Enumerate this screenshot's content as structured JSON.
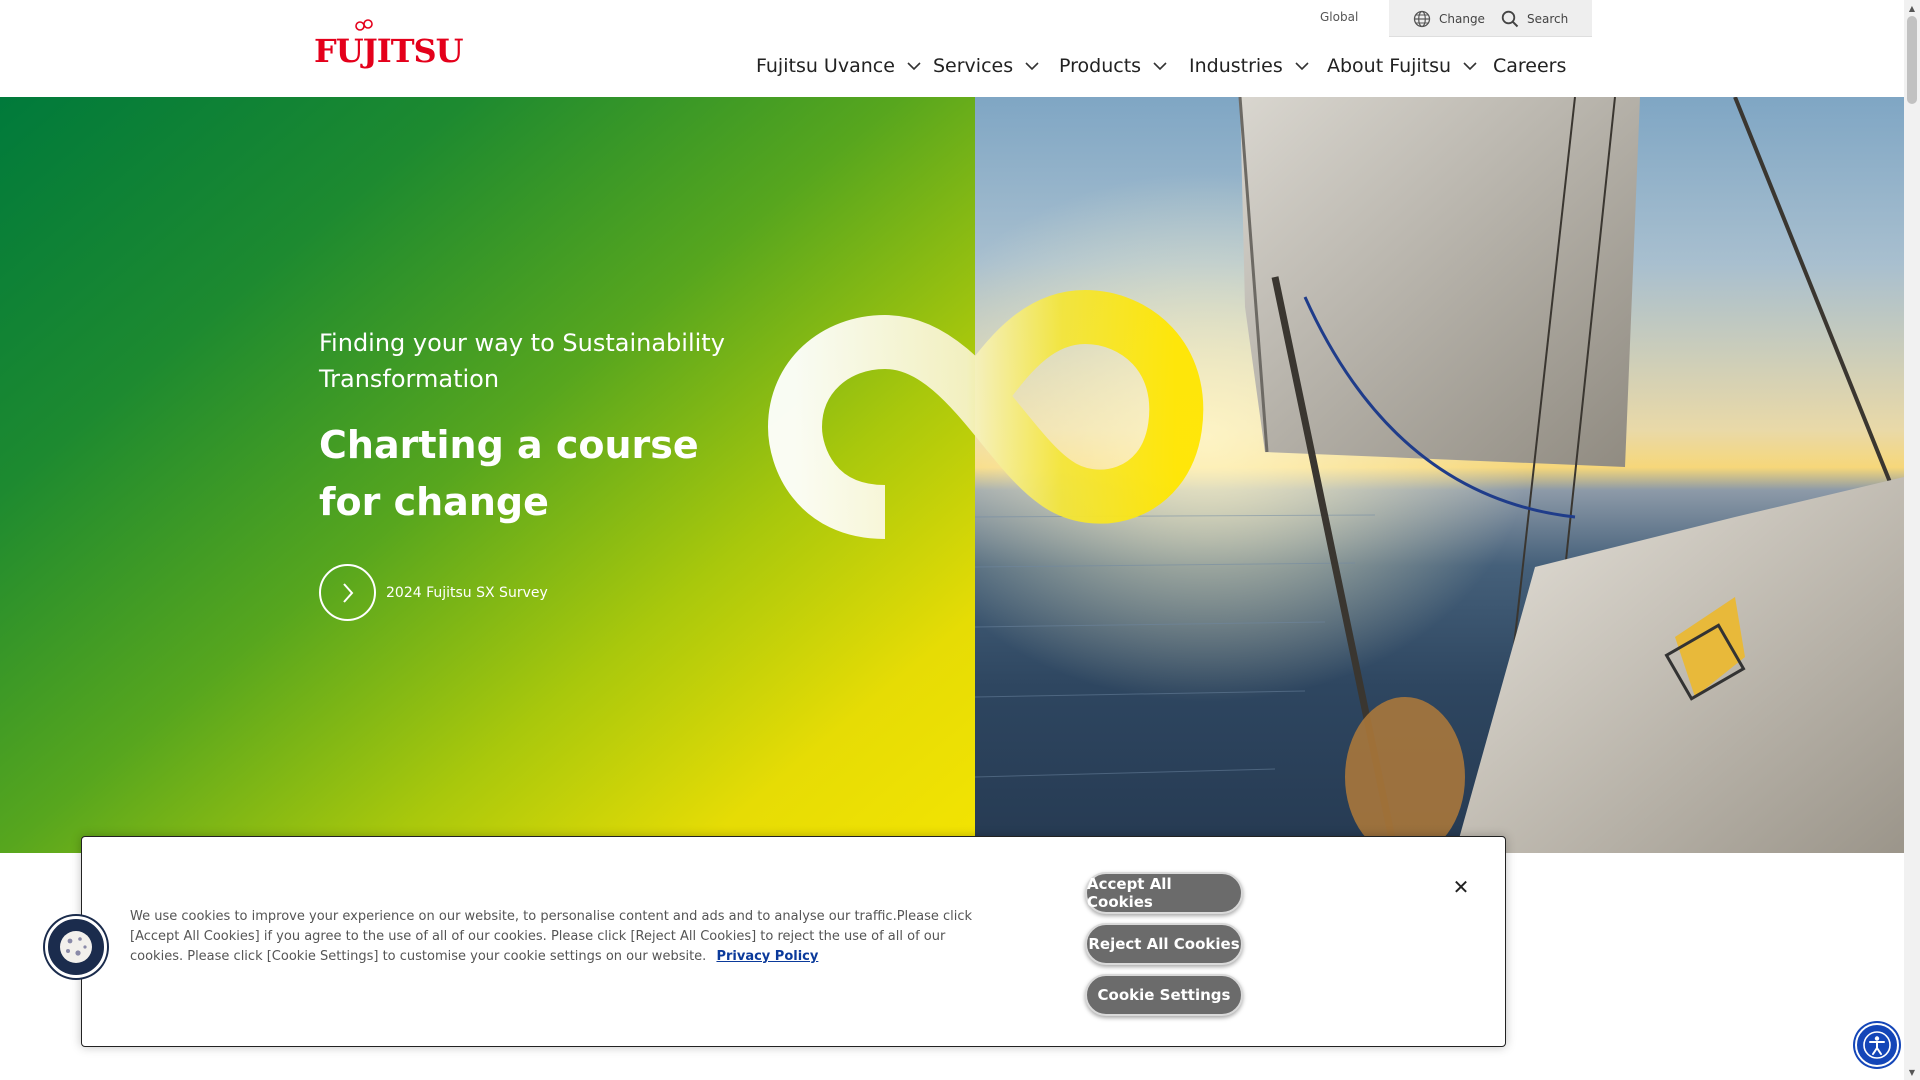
{
  "logo": {
    "text": "FUJITSU"
  },
  "utility": {
    "global_label": "Global",
    "change_label": "Change",
    "search_label": "Search"
  },
  "nav": {
    "items": [
      {
        "label": "Fujitsu Uvance",
        "has_dropdown": true
      },
      {
        "label": "Services",
        "has_dropdown": true
      },
      {
        "label": "Products",
        "has_dropdown": true
      },
      {
        "label": "Industries",
        "has_dropdown": true
      },
      {
        "label": "About Fujitsu",
        "has_dropdown": true
      },
      {
        "label": "Careers",
        "has_dropdown": false
      }
    ]
  },
  "hero": {
    "subtitle": "Finding your way to Sustainability Transformation",
    "headline": "Charting a course for change",
    "cta_label": "2024 Fujitsu SX Survey"
  },
  "cookie_banner": {
    "text": "We use cookies to improve your experience on our website, to personalise content and ads and to analyse our traffic.Please click [Accept All Cookies] if you agree to the use of all of our cookies. Please click [Reject All Cookies] to reject the use of all of our cookies. Please click [Cookie Settings] to customise your cookie settings on our website.",
    "privacy_link": "Privacy Policy",
    "accept_label": "Accept All Cookies",
    "reject_label": "Reject All Cookies",
    "settings_label": "Cookie Settings",
    "close_glyph": "✕"
  },
  "colors": {
    "brand_red": "#e4001b",
    "gradient_green": "#007a3b",
    "gradient_yellow": "#f3e402",
    "button_gray": "#6b6b6b",
    "link_blue": "#0b3a9b",
    "a11y_blue": "#1446b8"
  },
  "icons": {
    "globe": "globe-icon",
    "search": "search-icon",
    "chevron": "chevron-down-icon",
    "cta_arrow": "chevron-right-icon",
    "cookie": "cookie-icon",
    "accessibility": "accessibility-icon",
    "close": "close-icon"
  }
}
